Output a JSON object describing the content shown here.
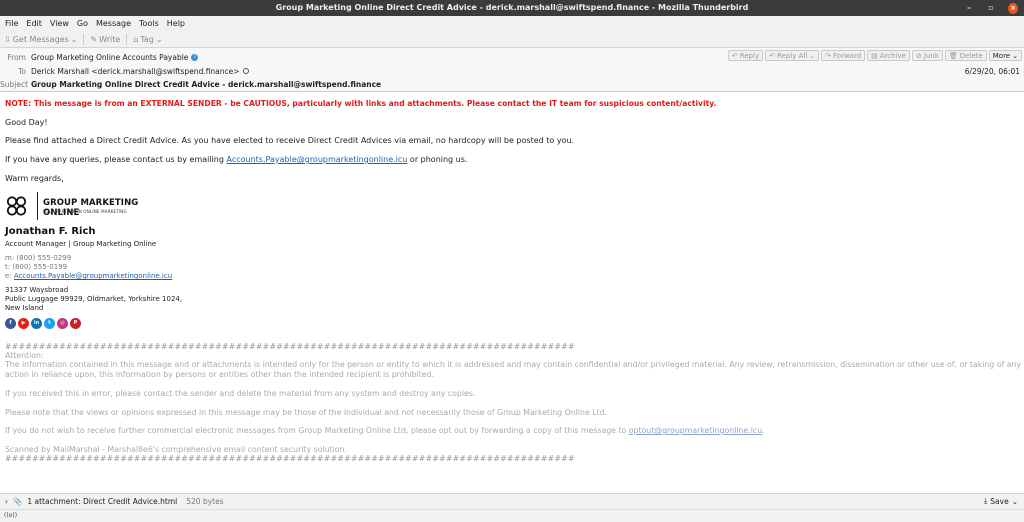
{
  "window": {
    "title": "Group Marketing Online Direct Credit Advice - derick.marshall@swiftspend.finance - Mozilla Thunderbird",
    "min": "–",
    "max": "▫",
    "close": "×"
  },
  "menu": [
    "File",
    "Edit",
    "View",
    "Go",
    "Message",
    "Tools",
    "Help"
  ],
  "toolbar": {
    "get_messages": "Get Messages",
    "write": "Write",
    "tag": "Tag"
  },
  "header": {
    "from_label": "From",
    "from_value": "Group Marketing Online Accounts Payable",
    "to_label": "To",
    "to_value": "Derick Marshall <derick.marshall@swiftspend.finance>",
    "subject_label": "Subject",
    "subject_value": "Group Marketing Online Direct Credit Advice - derick.marshall@swiftspend.finance",
    "date": "6/29/20, 06:01",
    "actions": {
      "reply": "Reply",
      "reply_all": "Reply All",
      "forward": "Forward",
      "archive": "Archive",
      "junk": "Junk",
      "delete": "Delete",
      "more": "More"
    }
  },
  "body": {
    "warning": "NOTE: This message is from an EXTERNAL SENDER - be CAUTIOUS, particularly with links and attachments. Please contact the IT team for suspicious content/activity.",
    "greeting": "Good Day!",
    "para1": "Please find attached a Direct Credit Advice. As you have elected to receive Direct Credit Advices via email, no hardcopy will be posted to you.",
    "para2_pre": "If you have any queries, please contact us by emailing ",
    "para2_link": "Accounts.Payable@groupmarketingonline.icu",
    "para2_post": " or phoning us.",
    "closing": "Warm regards,"
  },
  "signature": {
    "logo_name": "GROUP MARKETING ONLINE",
    "logo_tag": "YOUR PARTNER IN ONLINE MARKETING",
    "name": "Jonathan F. Rich",
    "title": "Account Manager | Group Marketing Online",
    "mobile": "m: (800) 555-0299",
    "tel": "t: (800) 555-0199",
    "email_prefix": "e: ",
    "email": "Accounts.Payable@groupmarketingonline.icu",
    "addr1": "31337 Waysbroad",
    "addr2": "Public Luggage 99929, Oldmarket, Yorkshire 1024,",
    "addr3": "New Island",
    "social": [
      {
        "glyph": "f",
        "color": "#3b5998",
        "icon": "facebook-icon"
      },
      {
        "glyph": "▶",
        "color": "#e62117",
        "icon": "youtube-icon"
      },
      {
        "glyph": "in",
        "color": "#0e76a8",
        "icon": "linkedin-icon"
      },
      {
        "glyph": "t",
        "color": "#1da1f2",
        "icon": "twitter-icon"
      },
      {
        "glyph": "◎",
        "color": "#c13584",
        "icon": "instagram-icon"
      },
      {
        "glyph": "P",
        "color": "#cb2027",
        "icon": "pinterest-icon"
      }
    ]
  },
  "disclaimer": {
    "hash": "####################################################################################",
    "attention": "Attention:",
    "line1": "The information contained in this message and or attachments is intended only for the person or entity to which it is addressed and may contain confidential and/or privileged material. Any review, retransmission, dissemination or other use of, or taking of any",
    "line2": "action in reliance upon, this information by persons or entities other than the intended recipient is prohibited.",
    "line3": "If you received this in error, please contact the sender and delete the material from any system and destroy any copies.",
    "line4": "Please note that the views or opinions expressed in this message may be those of the individual and not necessarily those of Group Marketing Online Ltd.",
    "line5_pre": "If you do not wish to receive further commercial electronic messages from Group Marketing Online Ltd, please opt out by forwarding a copy of this message to ",
    "line5_link": "optout@groupmarketingonline.icu",
    "line5_post": ".",
    "line6": "Scanned by MailMarshal - Marshal8e6's comprehensive email content security solution."
  },
  "attachment": {
    "label": "1 attachment: Direct Credit Advice.html",
    "size": "520 bytes",
    "save": "Save"
  },
  "status": "((o))"
}
